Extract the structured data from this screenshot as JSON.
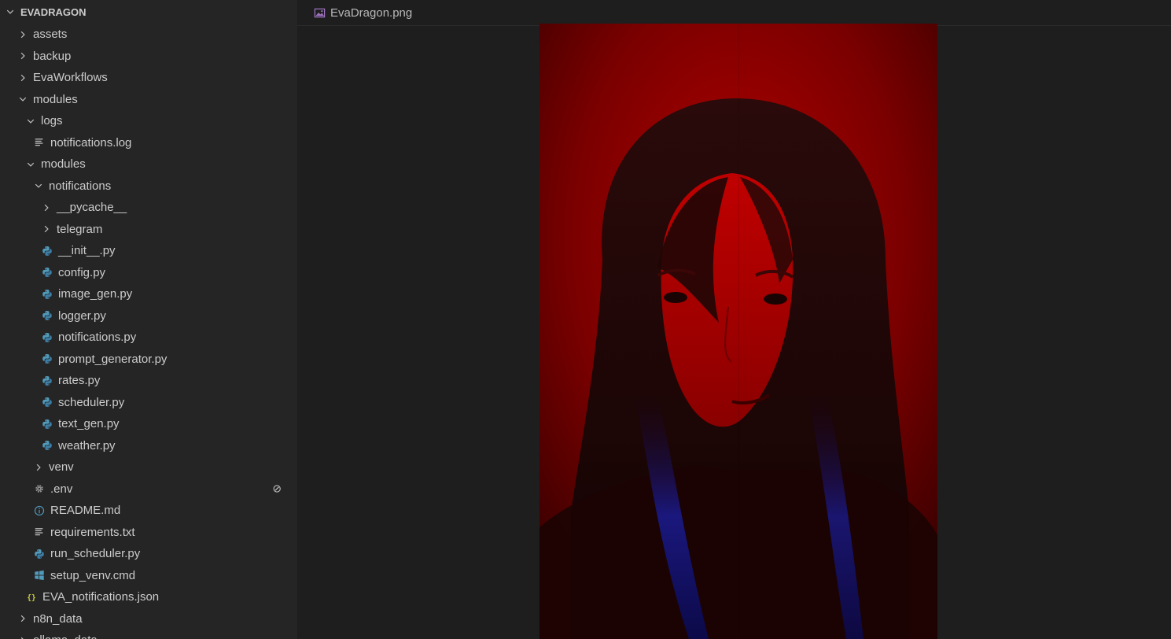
{
  "explorer": {
    "root_label": "EVADRAGON",
    "items": [
      {
        "label": "assets",
        "kind": "folder",
        "depth": 1,
        "expanded": false
      },
      {
        "label": "backup",
        "kind": "folder",
        "depth": 1,
        "expanded": false
      },
      {
        "label": "EvaWorkflows",
        "kind": "folder",
        "depth": 1,
        "expanded": false
      },
      {
        "label": "modules",
        "kind": "folder",
        "depth": 1,
        "expanded": true
      },
      {
        "label": "logs",
        "kind": "folder",
        "depth": 2,
        "expanded": true
      },
      {
        "label": "notifications.log",
        "kind": "file",
        "icon": "lines-icon",
        "depth": 3
      },
      {
        "label": "modules",
        "kind": "folder",
        "depth": 2,
        "expanded": true
      },
      {
        "label": "notifications",
        "kind": "folder",
        "depth": 3,
        "expanded": true
      },
      {
        "label": "__pycache__",
        "kind": "folder",
        "depth": 4,
        "expanded": false
      },
      {
        "label": "telegram",
        "kind": "folder",
        "depth": 4,
        "expanded": false
      },
      {
        "label": "__init__.py",
        "kind": "file",
        "icon": "python-icon",
        "depth": 4
      },
      {
        "label": "config.py",
        "kind": "file",
        "icon": "python-icon",
        "depth": 4
      },
      {
        "label": "image_gen.py",
        "kind": "file",
        "icon": "python-icon",
        "depth": 4
      },
      {
        "label": "logger.py",
        "kind": "file",
        "icon": "python-icon",
        "depth": 4
      },
      {
        "label": "notifications.py",
        "kind": "file",
        "icon": "python-icon",
        "depth": 4
      },
      {
        "label": "prompt_generator.py",
        "kind": "file",
        "icon": "python-icon",
        "depth": 4
      },
      {
        "label": "rates.py",
        "kind": "file",
        "icon": "python-icon",
        "depth": 4
      },
      {
        "label": "scheduler.py",
        "kind": "file",
        "icon": "python-icon",
        "depth": 4
      },
      {
        "label": "text_gen.py",
        "kind": "file",
        "icon": "python-icon",
        "depth": 4
      },
      {
        "label": "weather.py",
        "kind": "file",
        "icon": "python-icon",
        "depth": 4
      },
      {
        "label": "venv",
        "kind": "folder",
        "depth": 3,
        "expanded": false
      },
      {
        "label": ".env",
        "kind": "file",
        "icon": "gear-icon",
        "depth": 3,
        "badge": "⊘"
      },
      {
        "label": "README.md",
        "kind": "file",
        "icon": "info-icon",
        "depth": 3
      },
      {
        "label": "requirements.txt",
        "kind": "file",
        "icon": "lines-icon",
        "depth": 3
      },
      {
        "label": "run_scheduler.py",
        "kind": "file",
        "icon": "python-icon",
        "depth": 3
      },
      {
        "label": "setup_venv.cmd",
        "kind": "file",
        "icon": "windows-icon",
        "depth": 3
      },
      {
        "label": "EVA_notifications.json",
        "kind": "file",
        "icon": "json-icon",
        "depth": 2
      },
      {
        "label": "n8n_data",
        "kind": "folder",
        "depth": 1,
        "expanded": false
      },
      {
        "label": "ollama_data",
        "kind": "folder",
        "depth": 1,
        "expanded": false
      }
    ]
  },
  "editor": {
    "tab_label": "EvaDragon.png",
    "tab_icon": "image-file-icon"
  },
  "colors": {
    "sidebar_bg": "#252526",
    "editor_bg": "#1e1e1e",
    "python_icon": "#519aba",
    "json_icon": "#cbcb41",
    "image_icon": "#a074c4",
    "image_tone": "#b00000"
  }
}
